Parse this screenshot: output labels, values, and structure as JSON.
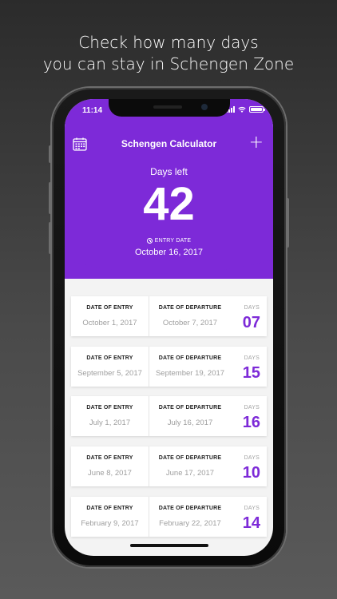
{
  "caption": {
    "line1": "Check how many days",
    "line2": "you can stay in Schengen Zone"
  },
  "status_bar": {
    "time": "11:14"
  },
  "header": {
    "title": "Schengen Calculator",
    "calendar_icon": "calendar-icon",
    "add_icon": "+",
    "days_left_label": "Days left",
    "days_left_value": "42",
    "entry_date_label": "ENTRY DATE",
    "entry_date_value": "October 16, 2017"
  },
  "colors": {
    "accent": "#7d2ad8"
  },
  "trips": [
    {
      "entry_label": "DATE OF ENTRY",
      "entry_date": "October 1, 2017",
      "departure_label": "DATE OF DEPARTURE",
      "departure_date": "October 7, 2017",
      "days_label": "DAYS",
      "days": "07"
    },
    {
      "entry_label": "DATE OF ENTRY",
      "entry_date": "September 5, 2017",
      "departure_label": "DATE OF DEPARTURE",
      "departure_date": "September 19, 2017",
      "days_label": "DAYS",
      "days": "15"
    },
    {
      "entry_label": "DATE OF ENTRY",
      "entry_date": "July 1, 2017",
      "departure_label": "DATE OF DEPARTURE",
      "departure_date": "July 16, 2017",
      "days_label": "DAYS",
      "days": "16"
    },
    {
      "entry_label": "DATE OF ENTRY",
      "entry_date": "June 8, 2017",
      "departure_label": "DATE OF DEPARTURE",
      "departure_date": "June 17, 2017",
      "days_label": "DAYS",
      "days": "10"
    },
    {
      "entry_label": "DATE OF ENTRY",
      "entry_date": "February 9, 2017",
      "departure_label": "DATE OF DEPARTURE",
      "departure_date": "February 22, 2017",
      "days_label": "DAYS",
      "days": "14"
    }
  ]
}
